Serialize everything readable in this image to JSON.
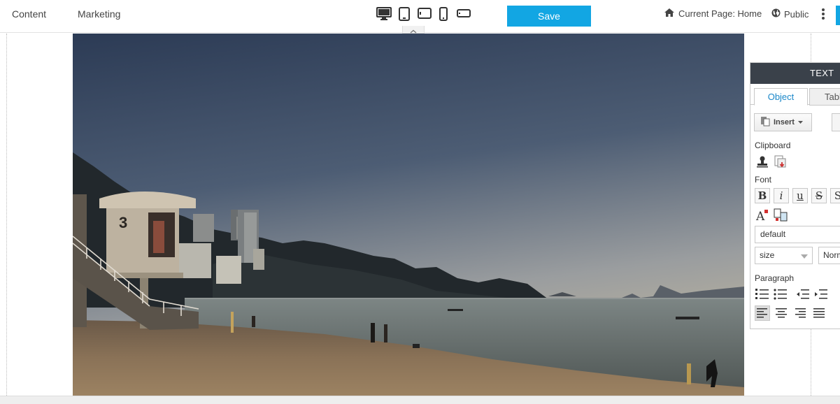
{
  "nav": {
    "content_label": "Content",
    "marketing_label": "Marketing"
  },
  "devices": [
    "desktop-icon",
    "tablet-portrait-icon",
    "tablet-landscape-icon",
    "phone-portrait-icon",
    "phone-landscape-icon"
  ],
  "toolbar": {
    "save_label": "Save",
    "current_page": "Current Page: Home",
    "visibility": "Public"
  },
  "colors": {
    "accent": "#12a6e3",
    "panel_header": "#3a414a",
    "tab_active_text": "#1a87c9"
  },
  "text_panel": {
    "title": "TEXT",
    "tabs": [
      {
        "label": "Object",
        "active": true
      },
      {
        "label": "Table",
        "active": false
      }
    ],
    "insert_label": "Insert",
    "sections": {
      "clipboard": "Clipboard",
      "font": "Font",
      "paragraph": "Paragraph"
    },
    "font_family_value": "default",
    "font_size_placeholder": "size",
    "font_style_value": "Normal"
  }
}
